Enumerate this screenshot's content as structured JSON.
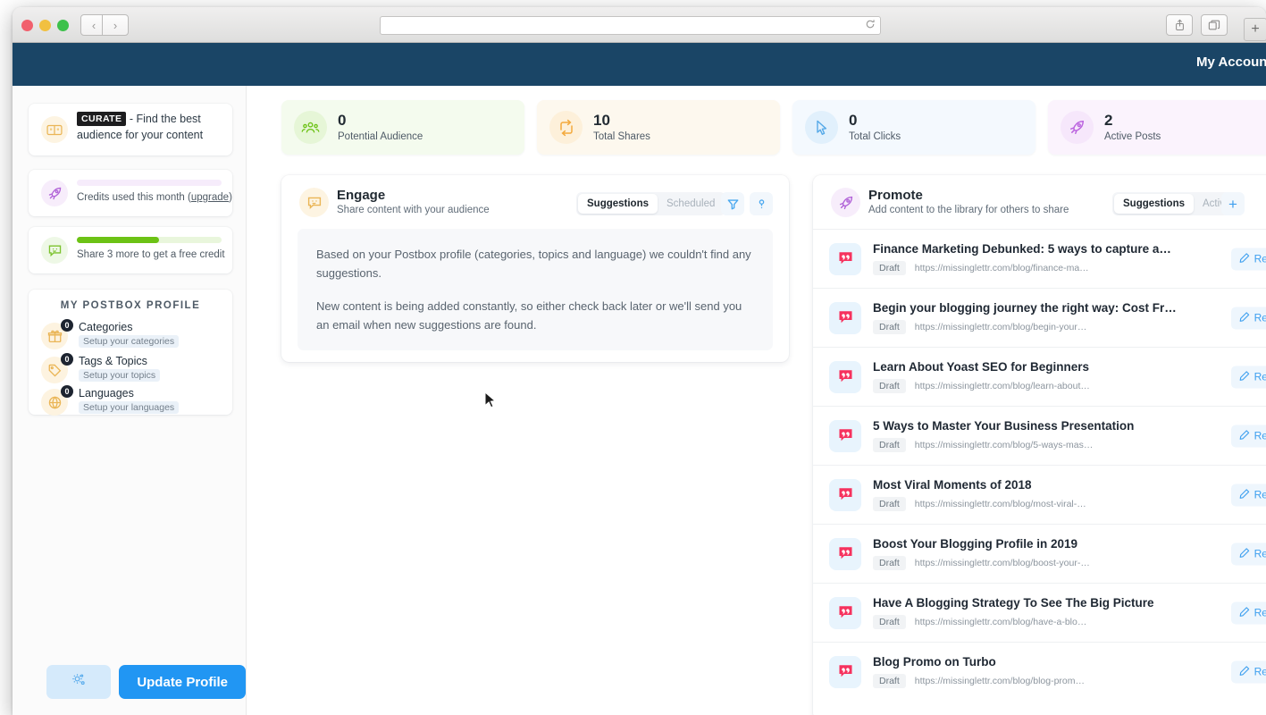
{
  "browser": {
    "url_value": "",
    "url_placeholder": "",
    "reload_icon": "reload-icon",
    "back_icon": "‹",
    "forward_icon": "›",
    "share_icon": "share-icon",
    "tabs_icon": "tabs-icon",
    "newtab_icon": "+"
  },
  "app_header": {
    "account_label": "My Account",
    "background": "#1a4566"
  },
  "sidebar": {
    "curate": {
      "tag": "CURATE",
      "text": " - Find the best audience for your content",
      "icon": "curate-icon"
    },
    "credits": {
      "label_prefix": "Credits used this month (",
      "link": "upgrade",
      "label_suffix": ")",
      "icon": "rocket-icon",
      "progress": 0
    },
    "share": {
      "label": "Share 3 more to get a free credit",
      "icon": "chat-icon",
      "progress": 57
    },
    "profile": {
      "title": "MY POSTBOX PROFILE",
      "items": [
        {
          "badge": "0",
          "name": "Categories",
          "sub": "Setup your categories",
          "icon": "gift-icon"
        },
        {
          "badge": "0",
          "name": "Tags & Topics",
          "sub": "Setup your topics",
          "icon": "tag-icon"
        },
        {
          "badge": "0",
          "name": "Languages",
          "sub": "Setup your languages",
          "icon": "globe-icon"
        }
      ]
    },
    "footer": {
      "settings_icon": "settings-gear-icon",
      "update_label": "Update Profile",
      "accent": "#2196f3"
    }
  },
  "stats": [
    {
      "value": "0",
      "label": "Potential Audience",
      "icon": "people-icon",
      "card_class": "sc-green",
      "icon_class": "si-green",
      "color": "#6cc215"
    },
    {
      "value": "10",
      "label": "Total Shares",
      "icon": "repeat-icon",
      "card_class": "sc-amber",
      "icon_class": "si-amber",
      "color": "#f3a93c"
    },
    {
      "value": "0",
      "label": "Total Clicks",
      "icon": "cursor-icon",
      "card_class": "sc-blue",
      "icon_class": "si-blue",
      "color": "#56a9e8"
    },
    {
      "value": "2",
      "label": "Active Posts",
      "icon": "rocket-icon",
      "card_class": "sc-violet",
      "icon_class": "si-violet",
      "color": "#bb63df"
    }
  ],
  "engage": {
    "title": "Engage",
    "subtitle": "Share content with your audience",
    "icon": "chat-smile-icon",
    "tabs": {
      "active": "Suggestions",
      "inactive": "Scheduled"
    },
    "filter_icon": "filter-icon",
    "help_icon": "help-icon",
    "message_p1": "Based on your Postbox profile (categories, topics and language) we couldn't find any suggestions.",
    "message_p2": "New content is being added constantly, so either check back later or we'll send you an email when new suggestions are found."
  },
  "promote": {
    "title": "Promote",
    "subtitle": "Add content to the library for others to share",
    "icon": "rocket-icon",
    "tabs": {
      "active": "Suggestions",
      "inactive": "Active"
    },
    "add_icon": "+",
    "action_label": "Review",
    "action_icon": "pencil-icon",
    "status_label": "Draft",
    "items": [
      {
        "title": "Finance Marketing Debunked: 5 ways to capture a…",
        "status": "Draft",
        "url": "https://missinglettr.com/blog/finance-ma…",
        "action": "Review"
      },
      {
        "title": "Begin your blogging journey the right way: Cost Fr…",
        "status": "Draft",
        "url": "https://missinglettr.com/blog/begin-your…",
        "action": "Review"
      },
      {
        "title": "Learn About Yoast SEO for Beginners",
        "status": "Draft",
        "url": "https://missinglettr.com/blog/learn-about…",
        "action": "Review"
      },
      {
        "title": "5 Ways to Master Your Business Presentation",
        "status": "Draft",
        "url": "https://missinglettr.com/blog/5-ways-mas…",
        "action": "Review"
      },
      {
        "title": "Most Viral Moments of 2018",
        "status": "Draft",
        "url": "https://missinglettr.com/blog/most-viral-…",
        "action": "Review"
      },
      {
        "title": "Boost Your Blogging Profile in 2019",
        "status": "Draft",
        "url": "https://missinglettr.com/blog/boost-your-…",
        "action": "Review"
      },
      {
        "title": "Have A Blogging Strategy To See The Big Picture",
        "status": "Draft",
        "url": "https://missinglettr.com/blog/have-a-blo…",
        "action": "Review"
      },
      {
        "title": "Blog Promo on Turbo",
        "status": "Draft",
        "url": "https://missinglettr.com/blog/blog-prom…",
        "action": "Review"
      }
    ]
  }
}
